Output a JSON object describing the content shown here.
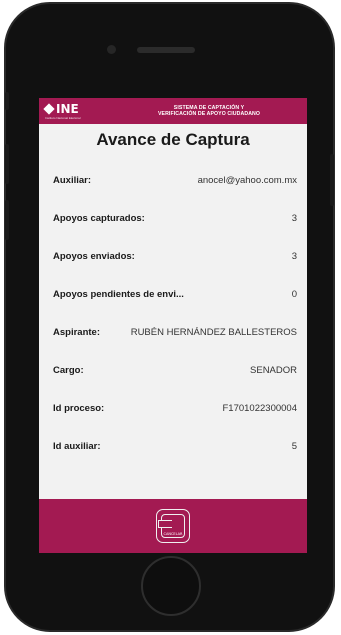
{
  "header": {
    "logo_text": "INE",
    "logo_subtext": "Instituto Nacional Electoral",
    "system_title_line1": "SISTEMA DE CAPTACIÓN Y",
    "system_title_line2": "VERIFICACIÓN DE APOYO CIUDADANO"
  },
  "page": {
    "title": "Avance de Captura"
  },
  "rows": [
    {
      "label": "Auxiliar:",
      "value": "anocel@yahoo.com.mx"
    },
    {
      "label": "Apoyos capturados:",
      "value": "3"
    },
    {
      "label": "Apoyos enviados:",
      "value": "3"
    },
    {
      "label": "Apoyos pendientes de envi...",
      "value": "0"
    },
    {
      "label": "Aspirante:",
      "value": "RUBÉN HERNÁNDEZ BALLESTEROS"
    },
    {
      "label": "Cargo:",
      "value": "SENADOR"
    },
    {
      "label": "Id proceso:",
      "value": "F1701022300004"
    },
    {
      "label": "Id auxiliar:",
      "value": "5"
    }
  ],
  "footer": {
    "cancel_label": "CANCELAR"
  },
  "colors": {
    "brand": "#a31a52",
    "background": "#f2f2f2"
  },
  "icons": {
    "cancel": "cancel-exit-icon",
    "logo": "ine-logo-icon"
  }
}
